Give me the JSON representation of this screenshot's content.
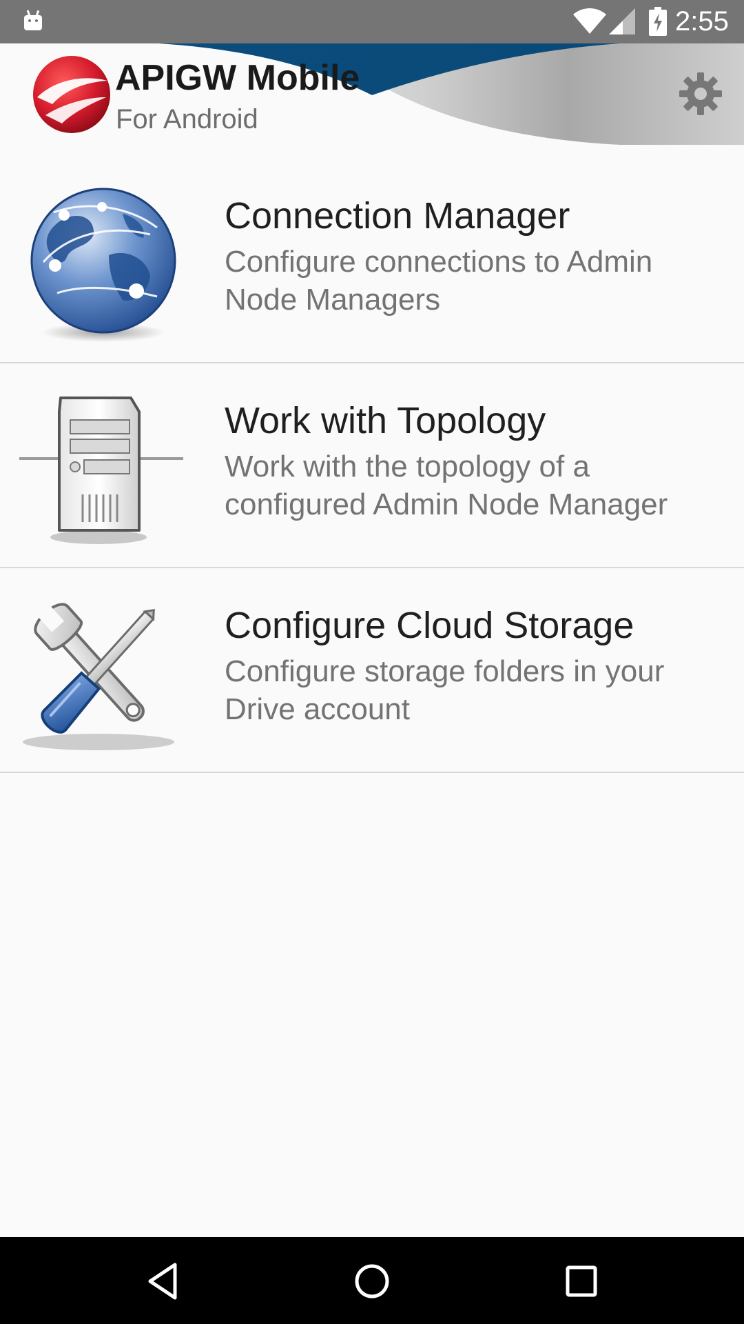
{
  "status_bar": {
    "time": "2:55",
    "icons": [
      "android-notification-icon",
      "wifi-icon",
      "signal-icon",
      "battery-charging-icon"
    ]
  },
  "header": {
    "title": "APIGW Mobile",
    "subtitle": "For Android",
    "logo_icon": "red-sphere-logo-icon",
    "settings_icon": "gear-icon"
  },
  "menu": {
    "items": [
      {
        "title": "Connection Manager",
        "description": "Configure connections to Admin Node Managers",
        "icon": "globe-icon"
      },
      {
        "title": "Work with Topology",
        "description": "Work with the topology of a configured Admin Node Manager",
        "icon": "server-icon"
      },
      {
        "title": "Configure Cloud Storage",
        "description": "Configure storage folders in your Drive account",
        "icon": "wrench-screwdriver-icon"
      }
    ]
  },
  "nav_bar": {
    "buttons": [
      "back-icon",
      "home-icon",
      "recent-apps-icon"
    ]
  },
  "colors": {
    "status_bar": "#757575",
    "background": "#fafafa",
    "header_swoosh_blue": "#0b4c7d",
    "logo_red": "#c8102e",
    "divider": "#d8d8d8",
    "nav_bar": "#000000"
  }
}
